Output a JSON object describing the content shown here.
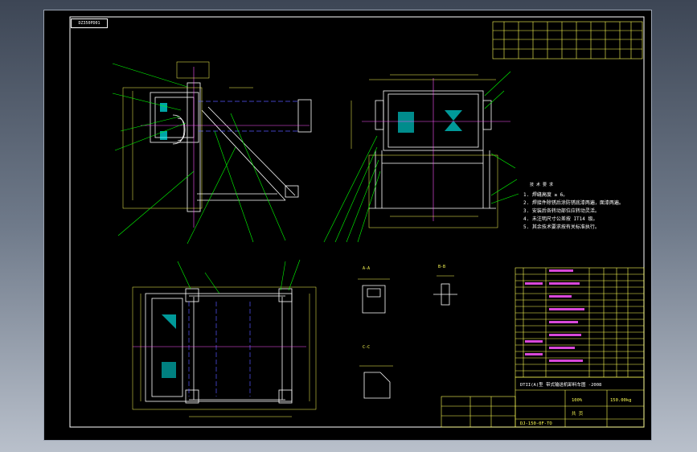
{
  "drawing": {
    "stamp": "DZ350PD01",
    "title_block_main": "DTII(A)型  带式输送机卸料车图 -2008",
    "scale_text": "100%",
    "weight_text": "150.00kg",
    "drawing_no": "DJ-150-0F-TO",
    "sheet_label": "共 页",
    "notes_title": "技 术 要 求",
    "notes": [
      "1. 焊缝高度 ≥ 6。",
      "2. 焊接件除锈后涂防锈底漆两遍，面漆两遍。",
      "3. 安装后各转动部位应转动灵活。",
      "4. 未注明尺寸公差按 IT14 级。",
      "5. 其余技术要求按有关标准执行。"
    ],
    "section_labels": [
      "A-A",
      "B-B",
      "C-C"
    ]
  },
  "colors": {
    "frame": "#ffffff",
    "outline": "#ffffff",
    "leader": "#00ff00",
    "dimension": "#ffff00",
    "centerline": "#ff00ff",
    "hidden": "#5555ff",
    "hatch": "#00ffff"
  }
}
